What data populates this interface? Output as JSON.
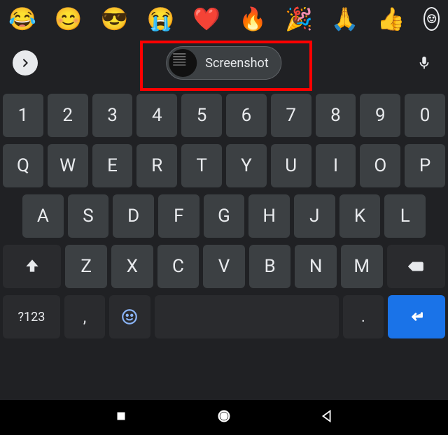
{
  "emoji_bar": {
    "items": [
      "😂",
      "😊",
      "😎",
      "😭",
      "❤️",
      "🔥",
      "🎉",
      "🙏",
      "👍"
    ]
  },
  "suggestion": {
    "clipboard_label": "Screenshot"
  },
  "keyboard": {
    "row1": [
      "1",
      "2",
      "3",
      "4",
      "5",
      "6",
      "7",
      "8",
      "9",
      "0"
    ],
    "row2": [
      "Q",
      "W",
      "E",
      "R",
      "T",
      "Y",
      "U",
      "I",
      "O",
      "P"
    ],
    "row3": [
      "A",
      "S",
      "D",
      "F",
      "G",
      "H",
      "J",
      "K",
      "L"
    ],
    "row4": [
      "Z",
      "X",
      "C",
      "V",
      "B",
      "N",
      "M"
    ],
    "special_label": "?123",
    "comma": ",",
    "period": "."
  }
}
